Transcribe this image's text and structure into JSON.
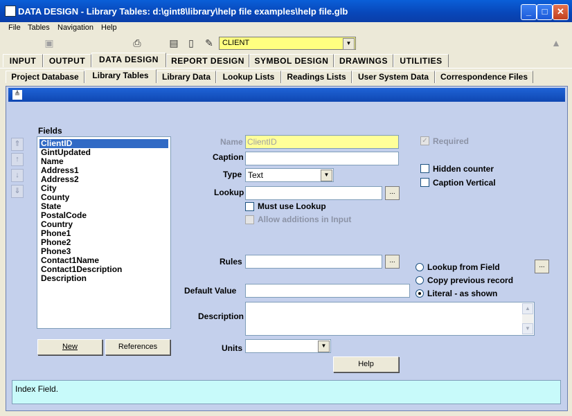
{
  "window": {
    "title": "DATA DESIGN - Library Tables:  d:\\gint8\\library\\help file examples\\help file.glb",
    "min": "_",
    "max": "□",
    "close": "✕"
  },
  "menu": [
    "File",
    "Tables",
    "Navigation",
    "Help"
  ],
  "toolbar": {
    "project_combo_value": "CLIENT"
  },
  "main_tabs": [
    "INPUT",
    "OUTPUT",
    "DATA DESIGN",
    "REPORT DESIGN",
    "SYMBOL DESIGN",
    "DRAWINGS",
    "UTILITIES"
  ],
  "main_tabs_active": "DATA DESIGN",
  "sub_tabs": [
    "Project Database",
    "Library Tables",
    "Library Data",
    "Lookup Lists",
    "Readings Lists",
    "User System Data",
    "Correspondence Files"
  ],
  "sub_tabs_active": "Library Tables",
  "fields": {
    "heading": "Fields",
    "items": [
      "ClientID",
      "GintUpdated",
      "Name",
      "Address1",
      "Address2",
      "City",
      "County",
      "State",
      "PostalCode",
      "Country",
      "Phone1",
      "Phone2",
      "Phone3",
      "Contact1Name",
      "Contact1Description",
      "Description"
    ],
    "selected": "ClientID",
    "new_button": "New",
    "references_button": "References"
  },
  "form": {
    "name_label": "Name",
    "name_value": "ClientID",
    "caption_label": "Caption",
    "caption_value": "",
    "type_label": "Type",
    "type_value": "Text",
    "lookup_label": "Lookup",
    "lookup_value": "",
    "lookup_browse": "...",
    "must_use_lookup": "Must use Lookup",
    "allow_additions": "Allow additions in Input",
    "rules_label": "Rules",
    "rules_value": "",
    "rules_browse": "...",
    "default_value_label": "Default Value",
    "default_value": "",
    "description_label": "Description",
    "description_value": "",
    "units_label": "Units",
    "units_value": "",
    "help_button": "Help",
    "required": "Required",
    "hidden_counter": "Hidden counter",
    "caption_vertical": "Caption Vertical",
    "default_options": [
      "Lookup from Field",
      "Copy previous record",
      "Literal - as shown"
    ],
    "default_option_selected": "Literal - as shown",
    "lookup_field_browse": "..."
  },
  "status": {
    "text": "Index Field."
  }
}
